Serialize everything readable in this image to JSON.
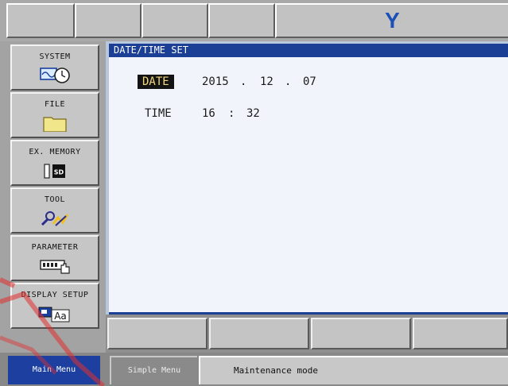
{
  "header": {
    "logo_text": "Y",
    "logo_color": "#1d4fb8"
  },
  "sidebar": {
    "items": [
      {
        "label": "SYSTEM",
        "icon": "system-clock-icon"
      },
      {
        "label": "FILE",
        "icon": "folder-icon"
      },
      {
        "label": "EX. MEMORY",
        "icon": "sd-card-icon"
      },
      {
        "label": "TOOL",
        "icon": "tool-wrench-icon"
      },
      {
        "label": "PARAMETER",
        "icon": "parameter-hand-icon"
      },
      {
        "label": "DISPLAY SETUP",
        "icon": "display-font-icon"
      }
    ]
  },
  "main": {
    "title": "DATE/TIME SET",
    "date": {
      "label": "DATE",
      "year": "2015",
      "month": "12",
      "day": "07",
      "separator": "."
    },
    "time": {
      "label": "TIME",
      "hour": "16",
      "minute": "32",
      "separator": ":"
    }
  },
  "footer": {
    "main_menu": "Main Menu",
    "simple_menu": "Simple Menu",
    "mode": "Maintenance mode"
  },
  "colors": {
    "title_bar": "#1b3f94",
    "main_menu_active": "#1c3fa0",
    "date_highlight": "#f4d87b"
  }
}
